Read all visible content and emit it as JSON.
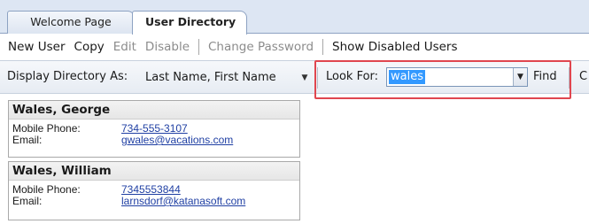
{
  "tabs": [
    {
      "label": "Welcome Page",
      "active": false
    },
    {
      "label": "User Directory",
      "active": true
    }
  ],
  "menu": {
    "new_user": "New User",
    "copy": "Copy",
    "edit": "Edit",
    "disable": "Disable",
    "change_password": "Change Password",
    "show_disabled": "Show Disabled Users"
  },
  "toolbar": {
    "display_label": "Display Directory As:",
    "display_value": "Last Name, First Name",
    "look_label": "Look For:",
    "look_value": "wales",
    "find_label": "Find",
    "truncated_label": "C"
  },
  "contacts": [
    {
      "name": "Wales, George",
      "mobile_label": "Mobile Phone:",
      "mobile": "734-555-3107",
      "email_label": "Email:",
      "email": "gwales@vacations.com"
    },
    {
      "name": "Wales, William",
      "mobile_label": "Mobile Phone:",
      "mobile": "7345553844",
      "email_label": "Email:",
      "email": "larnsdorf@katanasoft.com"
    }
  ],
  "colors": {
    "highlight": "#e0464f",
    "link": "#1f3fa3",
    "selection": "#3399ff"
  }
}
